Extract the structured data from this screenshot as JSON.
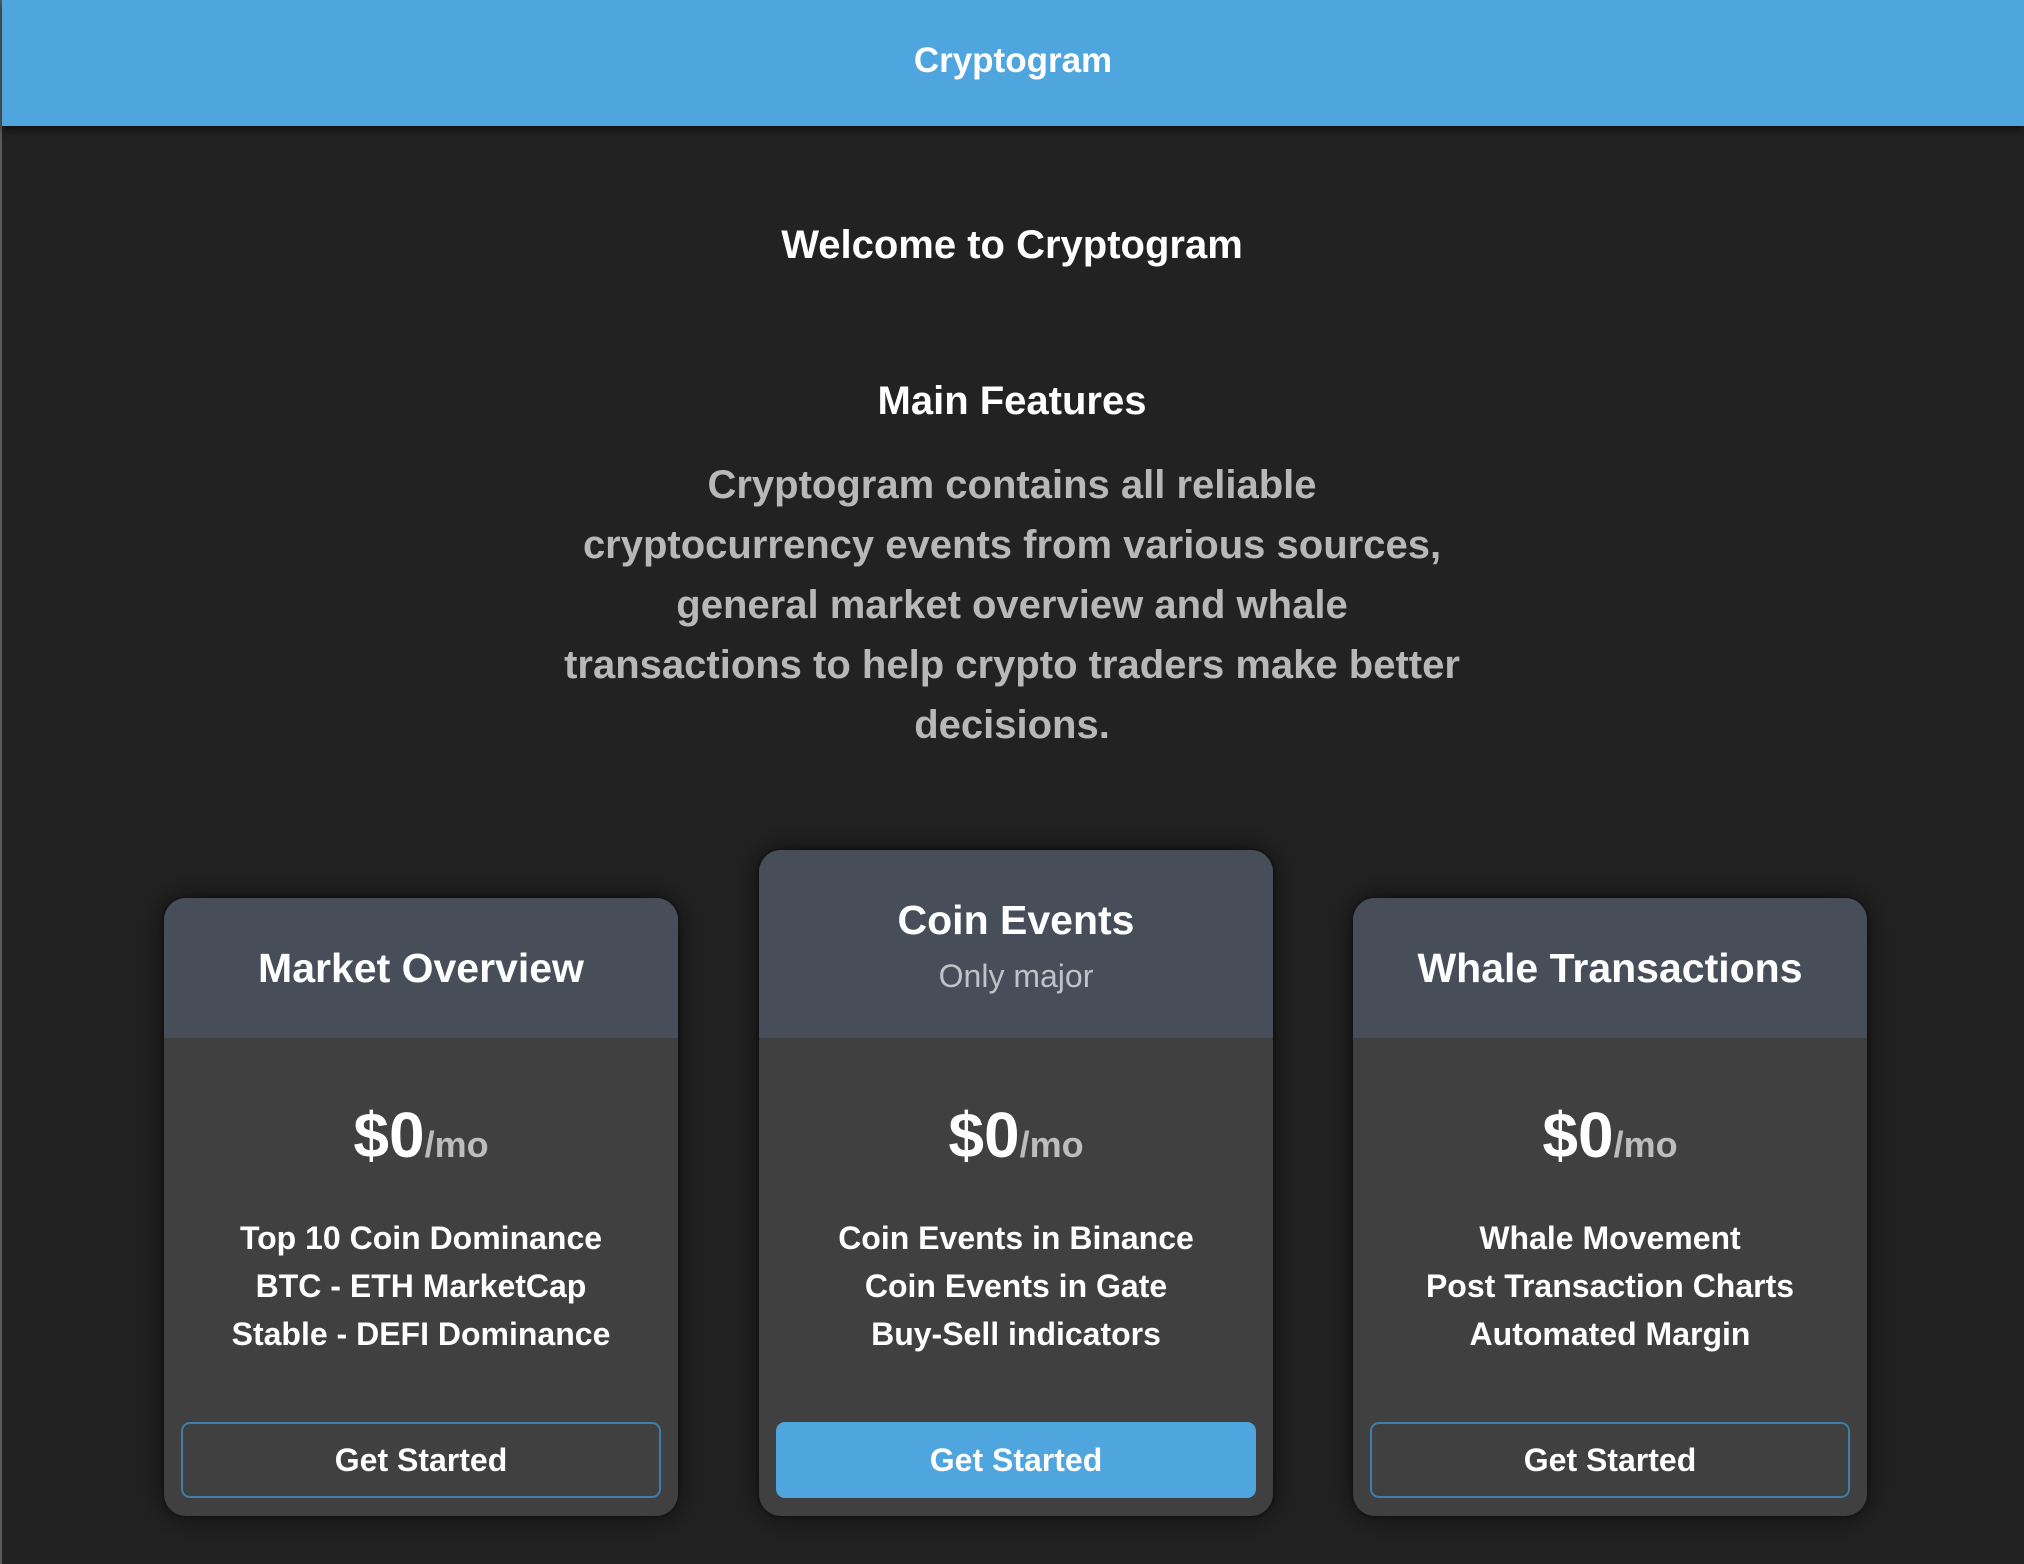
{
  "header": {
    "brand": "Cryptogram"
  },
  "hero": {
    "welcome": "Welcome to Cryptogram",
    "features_heading": "Main Features",
    "features_description": "Cryptogram contains all reliable cryptocurrency events from various sources, general market overview and whale transactions to help crypto traders make better decisions."
  },
  "plans": [
    {
      "title": "Market Overview",
      "price": "$0",
      "period": "/mo",
      "features": [
        "Top 10 Coin Dominance",
        "BTC - ETH MarketCap",
        "Stable - DEFI Dominance"
      ],
      "button": "Get Started"
    },
    {
      "title": "Coin Events",
      "subtitle": "Only major",
      "price": "$0",
      "period": "/mo",
      "features": [
        "Coin Events in Binance",
        "Coin Events in Gate",
        "Buy-Sell indicators"
      ],
      "button": "Get Started"
    },
    {
      "title": "Whale Transactions",
      "price": "$0",
      "period": "/mo",
      "features": [
        "Whale Movement",
        "Post Transaction Charts",
        "Automated Margin"
      ],
      "button": "Get Started"
    }
  ],
  "colors": {
    "accent": "#4fa6de",
    "background": "#222222",
    "card_body": "#404040",
    "card_header": "#474e59",
    "muted_text": "#b8b8b8"
  }
}
